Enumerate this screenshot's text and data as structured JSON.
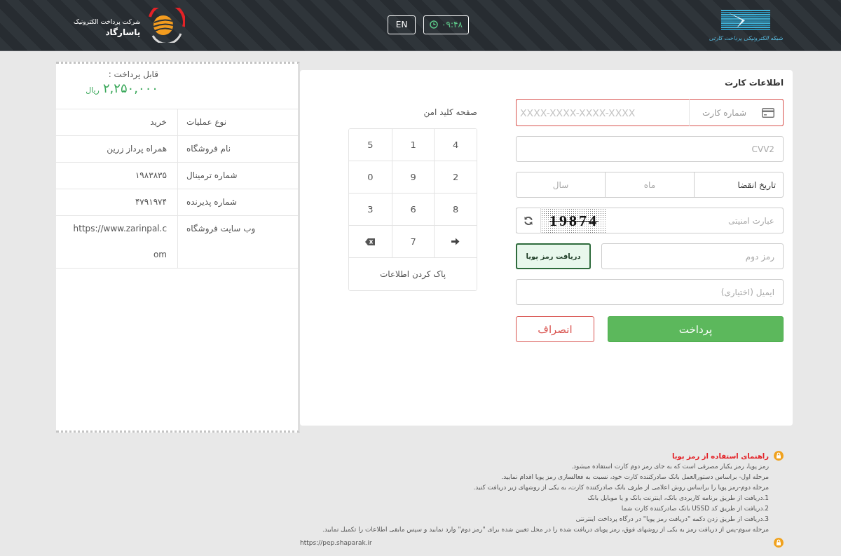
{
  "header": {
    "brand": {
      "line1": "شرکت پرداخت الکترونیک",
      "line2": "پاسارگاد"
    },
    "language_button": "EN",
    "clock": "۰۹:۴۸",
    "network_logo": {
      "caption": "شبکه الکترونیکی پرداخت کارتی"
    }
  },
  "card_form": {
    "title": "اطلاعات کارت",
    "card_number": {
      "label": "شماره کارت",
      "placeholder": "XXXX-XXXX-XXXX-XXXX",
      "error": true
    },
    "cvv2": {
      "placeholder": "CVV2"
    },
    "expiry": {
      "label": "تاریخ انقضا",
      "month_placeholder": "ماه",
      "year_placeholder": "سال"
    },
    "captcha": {
      "placeholder": "عبارت امنیتی",
      "code": "19874"
    },
    "second_password": {
      "placeholder": "رمز دوم",
      "request_button": "دریافت رمز پویا"
    },
    "email": {
      "placeholder": "ایمیل (اختیاری)"
    },
    "buttons": [
      {
        "kind": "primary",
        "label": "پرداخت"
      },
      {
        "kind": "cancel",
        "label": "انصراف"
      }
    ]
  },
  "keypad": {
    "title": "صفحه کلید امن",
    "keys": [
      {
        "kind": "digit",
        "label": "4"
      },
      {
        "kind": "digit",
        "label": "1"
      },
      {
        "kind": "digit",
        "label": "5"
      },
      {
        "kind": "digit",
        "label": "2"
      },
      {
        "kind": "digit",
        "label": "9"
      },
      {
        "kind": "digit",
        "label": "0"
      },
      {
        "kind": "digit",
        "label": "8"
      },
      {
        "kind": "digit",
        "label": "6"
      },
      {
        "kind": "digit",
        "label": "3"
      },
      {
        "kind": "arrow"
      },
      {
        "kind": "digit",
        "label": "7"
      },
      {
        "kind": "backspace"
      }
    ],
    "clear_button": "پاک کردن اطلاعات"
  },
  "receipt": {
    "amount_label": "قابل پرداخت :",
    "amount": "۲,۲۵۰,۰۰۰",
    "currency": "ریال",
    "rows": [
      {
        "label": "نوع عملیات",
        "value": "خرید"
      },
      {
        "label": "نام فروشگاه",
        "value": "همراه پرداز زرین"
      },
      {
        "label": "شماره ترمینال",
        "value": "۱۹۸۳۸۳۵"
      },
      {
        "label": "شماره پذیرنده",
        "value": "۴۷۹۱۹۷۴"
      },
      {
        "label": "وب سایت فروشگاه",
        "value": "https://www.zarinpal.com"
      }
    ]
  },
  "notices": [
    {
      "title": "راهنمای استفاده از رمز پویا",
      "lines": [
        "رمز پویا، رمز یکبار مصرفی است که به جای رمز دوم کارت استفاده میشود.",
        "مرحله اول- براساس دستورالعمل بانک صادرکننده کارت خود، نسبت به فعالسازی رمز پویا اقدام نمایید.",
        "مرحله دوم-رمز پویا را براساس روش اعلامی از طرف بانک صادرکننده کارت، به یکی از روشهای زیر دریافت کنید.",
        "1.دریافت از طریق برنامه کاربردی بانک، اینترنت بانک و یا موبایل بانک",
        "2.دریافت از طریق کد USSD بانک صادرکننده کارت شما",
        "3.دریافت از طریق زدن دکمه \"دریافت رمز پویا\" در درگاه پرداخت اینترنتی",
        "مرحله سوم-پس از دریافت رمز به یکی از روشهای فوق، رمز پویای دریافت شده را در محل تعیین شده برای \"رمز دوم\" وارد نمایید و سپس مابقی اطلاعات را تکمیل نمایید."
      ]
    },
    {
      "lines": [
        "https://pep.shaparak.ir"
      ]
    }
  ]
}
